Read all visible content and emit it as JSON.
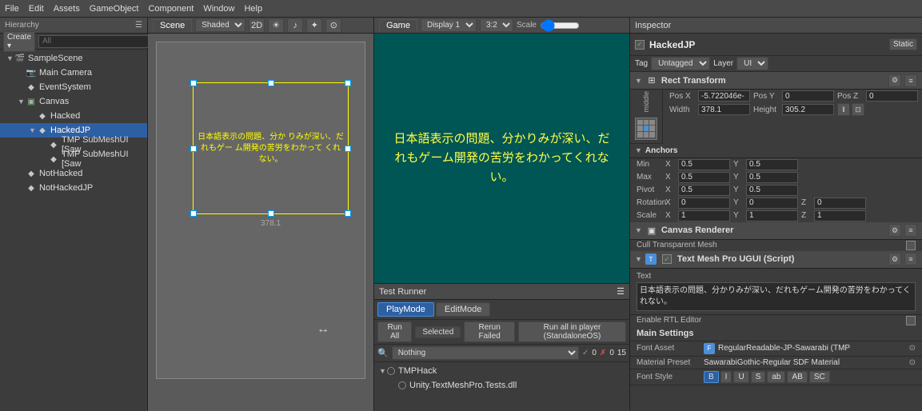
{
  "topBar": {
    "menus": [
      "File",
      "Edit",
      "Assets",
      "GameObject",
      "Component",
      "Window",
      "Help"
    ]
  },
  "hierarchy": {
    "title": "Hierarchy",
    "searchPlaceholder": "All",
    "items": [
      {
        "id": "sample-scene",
        "label": "SampleScene",
        "depth": 0,
        "icon": "scene",
        "expanded": true
      },
      {
        "id": "main-camera",
        "label": "Main Camera",
        "depth": 1,
        "icon": "camera"
      },
      {
        "id": "event-system",
        "label": "EventSystem",
        "depth": 1,
        "icon": "go"
      },
      {
        "id": "canvas",
        "label": "Canvas",
        "depth": 1,
        "icon": "canvas",
        "expanded": true
      },
      {
        "id": "hacked",
        "label": "Hacked",
        "depth": 2,
        "icon": "go"
      },
      {
        "id": "hackedjp",
        "label": "HackedJP",
        "depth": 2,
        "icon": "go",
        "selected": true
      },
      {
        "id": "tmp-sub-1",
        "label": "TMP SubMeshUI [Saw",
        "depth": 3,
        "icon": "go"
      },
      {
        "id": "tmp-sub-2",
        "label": "TMP SubMeshUI [Saw",
        "depth": 3,
        "icon": "go"
      },
      {
        "id": "not-hacked",
        "label": "NotHacked",
        "depth": 1,
        "icon": "go"
      },
      {
        "id": "not-hackedjp",
        "label": "NotHackedJP",
        "depth": 1,
        "icon": "go"
      }
    ]
  },
  "scene": {
    "title": "Scene",
    "shading": "Shaded",
    "mode2D": "2D",
    "textContent": "日本語表示の問題、分か\nりみが深い、だれもゲー\nム開発の苦労をわかって\nくれない。",
    "widthLabel": "378.1"
  },
  "game": {
    "title": "Game",
    "display": "Display 1",
    "aspect": "3:2",
    "scale": "Scale",
    "textContent": "日本語表示の問題、分かりみが深い、だれもゲーム開発の苦労をわかってくれない。"
  },
  "testRunner": {
    "title": "Test Runner",
    "modes": [
      "PlayMode",
      "EditMode"
    ],
    "activeMode": "PlayMode",
    "buttons": [
      "Run All",
      "Run Selected",
      "Rerun Failed",
      "Run all in player (StandaloneOS)"
    ],
    "selectedLabel": "Selected",
    "filterPlaceholder": "Nothing",
    "passCount": "0",
    "failCount": "0",
    "totalCount": "15",
    "items": [
      {
        "label": "TMPHack",
        "depth": 0,
        "expanded": true
      },
      {
        "label": "Unity.TextMeshPro.Tests.dll",
        "depth": 1
      }
    ]
  },
  "inspector": {
    "title": "Inspector",
    "objectName": "HackedJP",
    "static": "Static",
    "tag": "Untagged",
    "layer": "UI",
    "rectTransform": {
      "title": "Rect Transform",
      "modeLabel": "middle",
      "posX": "-5.722046e-",
      "posY": "0",
      "posZ": "0",
      "width": "378.1",
      "height": "305.2",
      "anchors": {
        "title": "Anchors",
        "minX": "0.5",
        "minY": "0.5",
        "maxX": "0.5",
        "maxY": "0.5"
      },
      "pivot": {
        "x": "0.5",
        "y": "0.5"
      },
      "rotation": {
        "title": "Rotation",
        "x": "0",
        "y": "0",
        "z": "0"
      },
      "scale": {
        "x": "1",
        "y": "1",
        "z": "1"
      }
    },
    "canvasRenderer": {
      "title": "Canvas Renderer",
      "cullLabel": "Cull Transparent Mesh"
    },
    "textMeshPro": {
      "title": "Text Mesh Pro UGUI (Script)",
      "textLabel": "Text",
      "textContent": "日本語表示の問題、分かりみが深い、だれもゲーム開発の苦労をわかってくれない。",
      "enableRtlLabel": "Enable RTL Editor",
      "mainSettings": "Main Settings",
      "fontAsset": {
        "label": "Font Asset",
        "value": "RegularReadable-JP-Sawarabi (TMP"
      },
      "materialPreset": {
        "label": "Material Preset",
        "value": "SawarabiGothic-Regular SDF Material"
      },
      "fontStyle": {
        "label": "Font Style",
        "buttons": [
          "B",
          "I",
          "U",
          "S",
          "ab",
          "AB",
          "SC"
        ]
      }
    }
  }
}
